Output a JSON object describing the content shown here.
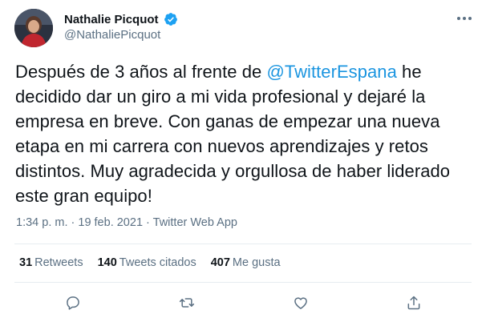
{
  "author": {
    "name": "Nathalie Picquot",
    "handle": "@NathaliePicquot",
    "verified_icon": "verified-badge-icon",
    "verified_color": "#1da1f2"
  },
  "tweet": {
    "line1_pre": "Después de 3 años al frente de ",
    "mention": "@TwitterEspana",
    "line1_post": " he",
    "line2": "decidido dar un giro a mi vida profesional y dejaré la",
    "line3": "empresa en breve. Con ganas de empezar una nueva",
    "line4": "etapa en mi carrera con nuevos aprendizajes y retos",
    "line5": "distintos. Muy agradecida y orgullosa de haber liderado",
    "line6": "este gran equipo!",
    "mention_color": "#1b95e0"
  },
  "meta": {
    "time": "1:34 p. m.",
    "separator": " · ",
    "date": "19 feb. 2021",
    "source": "Twitter Web App"
  },
  "stats": {
    "retweets_count": "31",
    "retweets_label": "Retweets",
    "quotes_count": "140",
    "quotes_label": "Tweets citados",
    "likes_count": "407",
    "likes_label": "Me gusta"
  },
  "actions": [
    "reply-icon",
    "retweet-icon",
    "like-icon",
    "share-icon"
  ],
  "colors": {
    "text": "#0f1419",
    "secondary": "#5b7083",
    "divider": "#e6ecf0"
  }
}
